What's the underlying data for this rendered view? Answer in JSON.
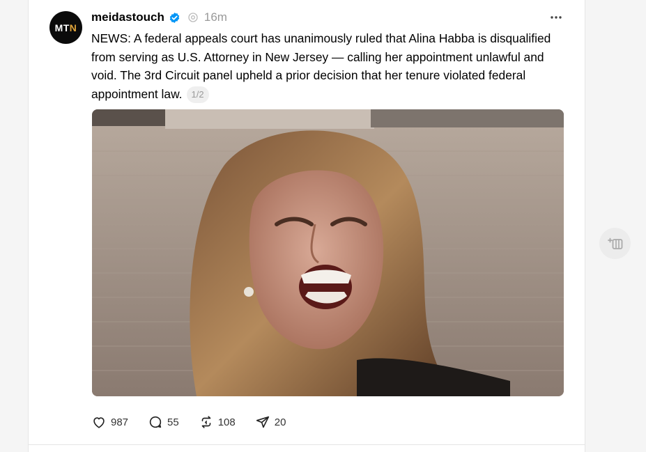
{
  "post": {
    "avatar_text_main": "MT",
    "avatar_text_accent": "N",
    "username": "meidastouch",
    "time": "16m",
    "text": "NEWS: A federal appeals court has unanimously ruled that Alina Habba is disqualified from serving as U.S. Attorney in New Jersey — calling her appointment unlawful and void. The 3rd Circuit panel upheld a prior decision that her tenure violated federal appointment law.",
    "page_indicator": "1/2"
  },
  "actions": {
    "likes": "987",
    "replies": "55",
    "reposts": "108",
    "shares": "20"
  },
  "colors": {
    "verified": "#0095f6",
    "muted": "#999999",
    "avatar_bg": "#0b0b0b",
    "avatar_accent": "#e0a43a"
  },
  "icons": [
    "verified-badge-icon",
    "threads-icon",
    "more-icon",
    "heart-icon",
    "comment-icon",
    "repost-icon",
    "share-icon",
    "add-column-icon"
  ]
}
